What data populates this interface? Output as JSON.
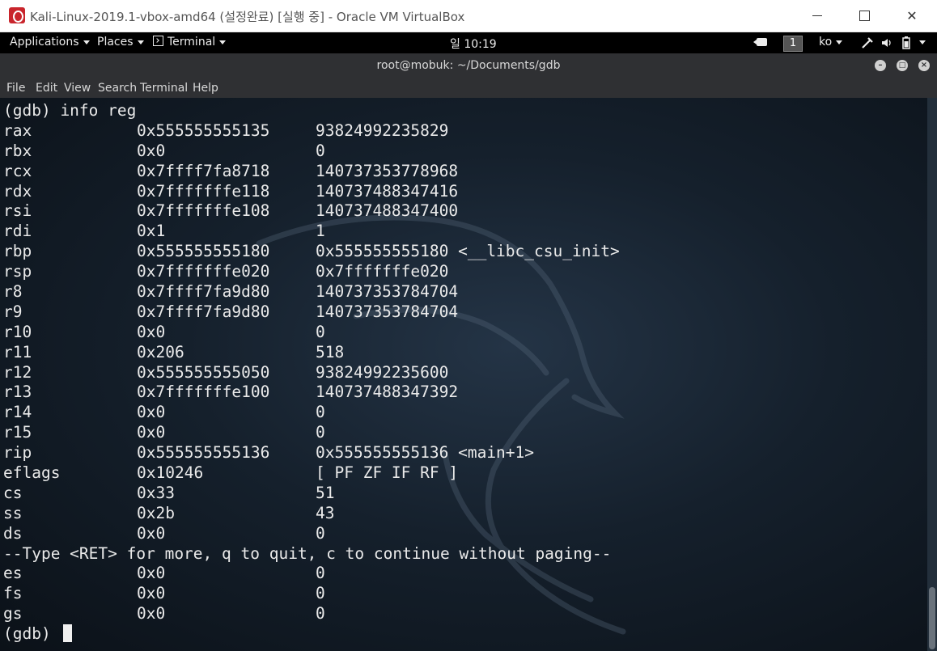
{
  "window": {
    "title": "Kali-Linux-2019.1-vbox-amd64 (설정완료) [실행 중] - Oracle VM VirtualBox",
    "minimize_glyph": "",
    "maximize_glyph": "",
    "close_glyph": "✕"
  },
  "topbar": {
    "applications": "Applications",
    "places": "Places",
    "terminal": "Terminal",
    "clock": "일 10:19",
    "workspace": "1",
    "lang": "ko"
  },
  "terminal": {
    "title": "root@mobuk: ~/Documents/gdb",
    "menu": [
      "File",
      "Edit",
      "View",
      "Search",
      "Terminal",
      "Help"
    ],
    "command": "(gdb) info reg",
    "registers": [
      {
        "name": "rax",
        "hex": "0x555555555135",
        "value": "93824992235829"
      },
      {
        "name": "rbx",
        "hex": "0x0",
        "value": "0"
      },
      {
        "name": "rcx",
        "hex": "0x7ffff7fa8718",
        "value": "140737353778968"
      },
      {
        "name": "rdx",
        "hex": "0x7fffffffe118",
        "value": "140737488347416"
      },
      {
        "name": "rsi",
        "hex": "0x7fffffffe108",
        "value": "140737488347400"
      },
      {
        "name": "rdi",
        "hex": "0x1",
        "value": "1"
      },
      {
        "name": "rbp",
        "hex": "0x555555555180",
        "value": "0x555555555180 <__libc_csu_init>"
      },
      {
        "name": "rsp",
        "hex": "0x7fffffffe020",
        "value": "0x7fffffffe020"
      },
      {
        "name": "r8",
        "hex": "0x7ffff7fa9d80",
        "value": "140737353784704"
      },
      {
        "name": "r9",
        "hex": "0x7ffff7fa9d80",
        "value": "140737353784704"
      },
      {
        "name": "r10",
        "hex": "0x0",
        "value": "0"
      },
      {
        "name": "r11",
        "hex": "0x206",
        "value": "518"
      },
      {
        "name": "r12",
        "hex": "0x555555555050",
        "value": "93824992235600"
      },
      {
        "name": "r13",
        "hex": "0x7fffffffe100",
        "value": "140737488347392"
      },
      {
        "name": "r14",
        "hex": "0x0",
        "value": "0"
      },
      {
        "name": "r15",
        "hex": "0x0",
        "value": "0"
      },
      {
        "name": "rip",
        "hex": "0x555555555136",
        "value": "0x555555555136 <main+1>"
      },
      {
        "name": "eflags",
        "hex": "0x10246",
        "value": "[ PF ZF IF RF ]"
      },
      {
        "name": "cs",
        "hex": "0x33",
        "value": "51"
      },
      {
        "name": "ss",
        "hex": "0x2b",
        "value": "43"
      },
      {
        "name": "ds",
        "hex": "0x0",
        "value": "0"
      }
    ],
    "pager": "--Type <RET> for more, q to quit, c to continue without paging--",
    "registers_after": [
      {
        "name": "es",
        "hex": "0x0",
        "value": "0"
      },
      {
        "name": "fs",
        "hex": "0x0",
        "value": "0"
      },
      {
        "name": "gs",
        "hex": "0x0",
        "value": "0"
      }
    ],
    "prompt": "(gdb) "
  }
}
